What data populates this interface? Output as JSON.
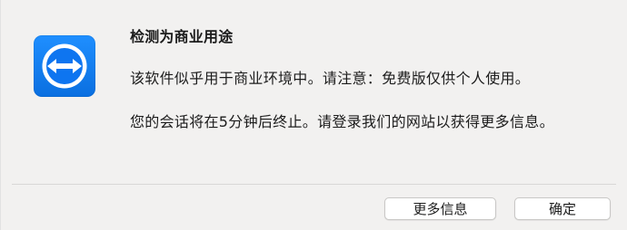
{
  "dialog": {
    "icon": "teamviewer-app-icon",
    "title": "检测为商业用途",
    "message_1": "该软件似乎用于商业环境中。请注意：免费版仅供个人使用。",
    "message_2": "您的会话将在5分钟后终止。请登录我们的网站以获得更多信息。",
    "buttons": {
      "more_info": "更多信息",
      "ok": "确定"
    }
  },
  "colors": {
    "icon_blue": "#0e75f0",
    "background": "#f2f1f0"
  }
}
